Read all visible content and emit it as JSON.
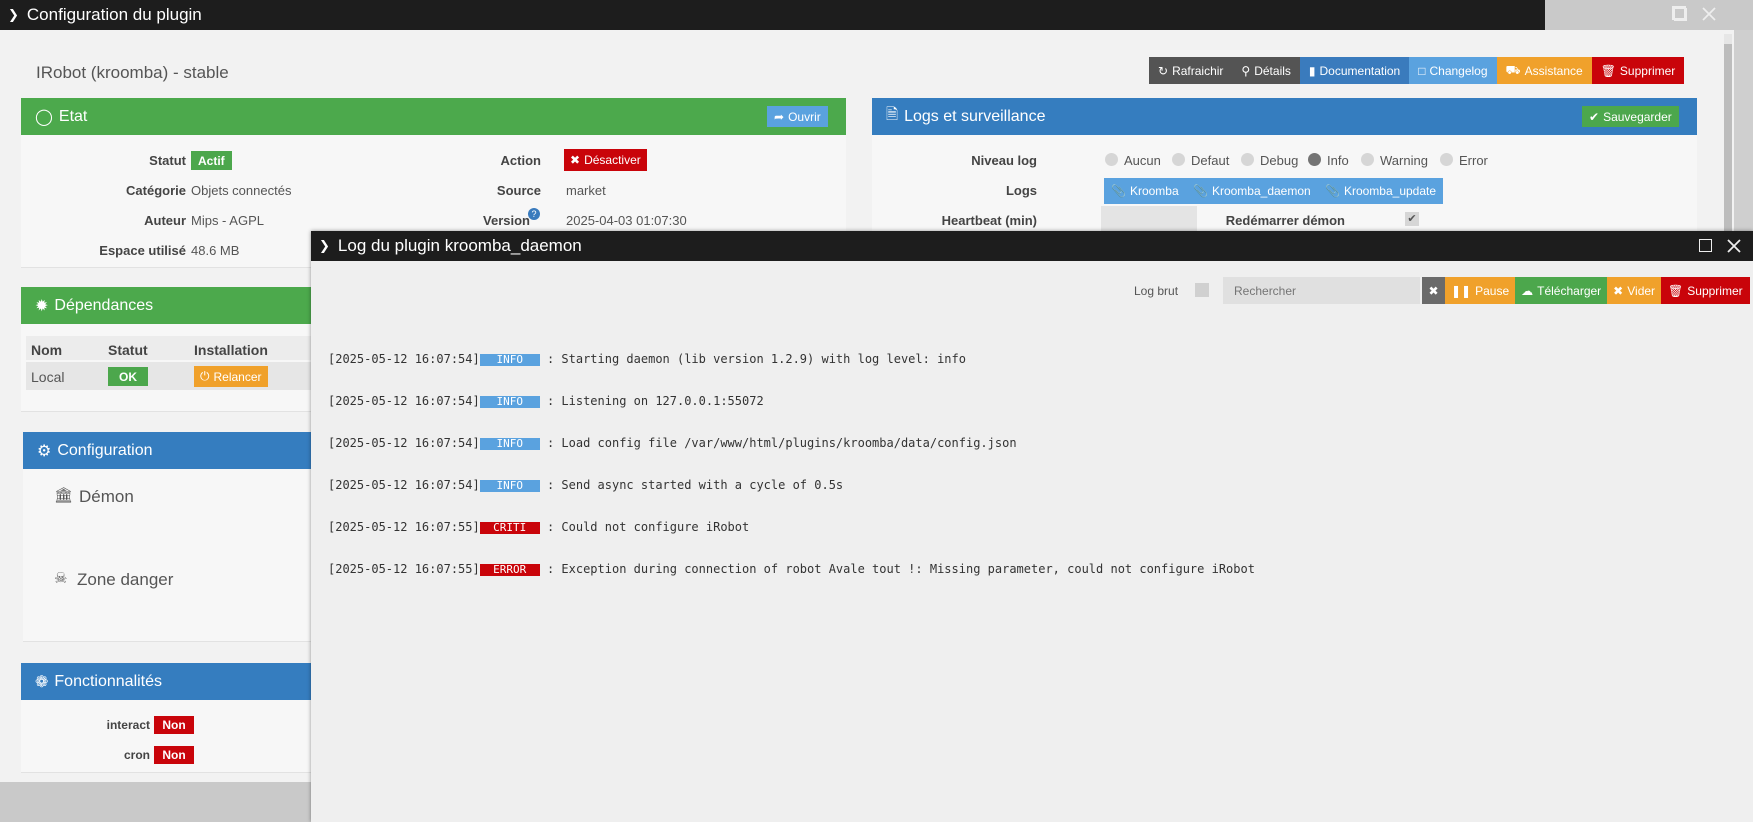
{
  "main_window": {
    "title": "Configuration du plugin",
    "plugin_name": "IRobot (kroomba) - stable",
    "toolbar": [
      "Rafraichir",
      "Détails",
      "Documentation",
      "Changelog",
      "Assistance",
      "Supprimer"
    ],
    "etat": {
      "title": "Etat",
      "open_button": "Ouvrir",
      "statut_label": "Statut",
      "statut_value": "Actif",
      "categorie_label": "Catégorie",
      "categorie_value": "Objets connectés",
      "auteur_label": "Auteur",
      "auteur_value": "Mips - AGPL",
      "espace_label": "Espace utilisé",
      "espace_value": "48.6 MB",
      "action_label": "Action",
      "action_button": "Désactiver",
      "source_label": "Source",
      "source_value": "market",
      "version_label": "Version",
      "version_value": "2025-04-03 01:07:30"
    },
    "dependances": {
      "title": "Dépendances",
      "headers": [
        "Nom",
        "Statut",
        "Installation"
      ],
      "row": {
        "nom": "Local",
        "statut": "OK",
        "installation": "Relancer"
      }
    },
    "configuration": {
      "title": "Configuration",
      "demon": "Démon",
      "zone_danger": "Zone danger"
    },
    "fonctionnalites": {
      "title": "Fonctionnalités",
      "items": [
        {
          "label": "interact",
          "value": "Non"
        },
        {
          "label": "cron",
          "value": "Non"
        }
      ]
    },
    "logs": {
      "title": "Logs et surveillance",
      "save_button": "Sauvegarder",
      "niveau_label": "Niveau log",
      "levels": [
        "Aucun",
        "Defaut",
        "Debug",
        "Info",
        "Warning",
        "Error"
      ],
      "selected_level": "Info",
      "logs_label": "Logs",
      "log_buttons": [
        "Kroomba",
        "Kroomba_daemon",
        "Kroomba_update"
      ],
      "heartbeat_label": "Heartbeat (min)",
      "restart_label": "Redémarrer démon"
    }
  },
  "log_window": {
    "title": "Log du plugin kroomba_daemon",
    "log_brut_label": "Log brut",
    "search_placeholder": "Rechercher",
    "buttons": [
      "Pause",
      "Télécharger",
      "Vider",
      "Supprimer"
    ],
    "lines": [
      {
        "ts": "[2025-05-12 16:07:54]",
        "level": "INFO",
        "msg": " : Starting daemon (lib version 1.2.9) with log level: info"
      },
      {
        "ts": "[2025-05-12 16:07:54]",
        "level": "INFO",
        "msg": " : Listening on 127.0.0.1:55072"
      },
      {
        "ts": "[2025-05-12 16:07:54]",
        "level": "INFO",
        "msg": " : Load config file /var/www/html/plugins/kroomba/data/config.json"
      },
      {
        "ts": "[2025-05-12 16:07:54]",
        "level": "INFO",
        "msg": " : Send async started with a cycle of 0.5s"
      },
      {
        "ts": "[2025-05-12 16:07:55]",
        "level": "CRITI",
        "msg": " : Could not configure iRobot"
      },
      {
        "ts": "[2025-05-12 16:07:55]",
        "level": "ERROR",
        "msg": " : Exception during connection of robot Avale tout !: Missing parameter, could not configure iRobot"
      }
    ]
  }
}
